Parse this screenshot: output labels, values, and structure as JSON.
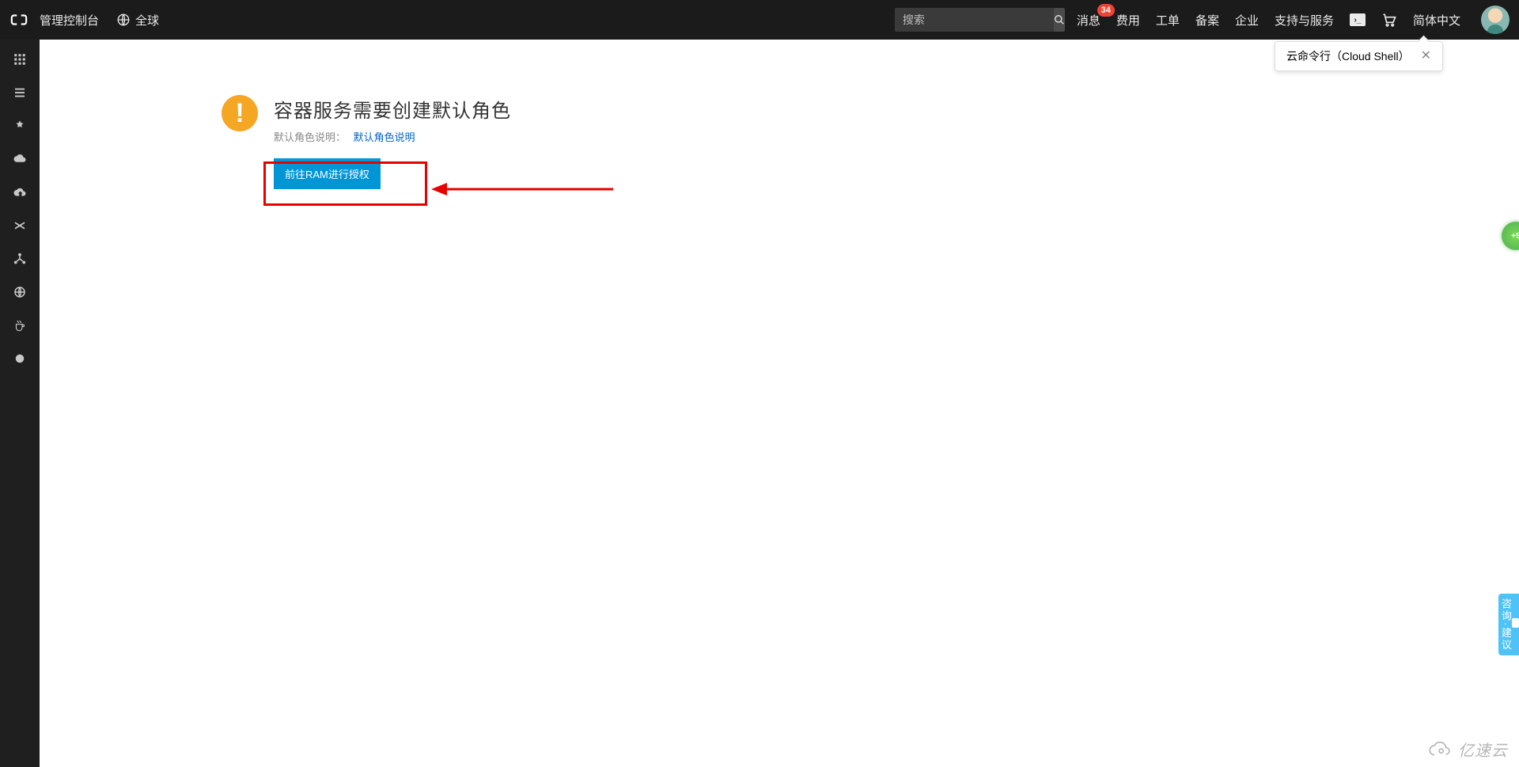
{
  "header": {
    "console_label": "管理控制台",
    "region_label": "全球",
    "search_placeholder": "搜索",
    "nav": {
      "messages": "消息",
      "messages_badge": "34",
      "billing": "费用",
      "tickets": "工单",
      "icp": "备案",
      "enterprise": "企业",
      "support": "支持与服务",
      "language": "简体中文"
    }
  },
  "tooltip": {
    "label": "云命令行（Cloud Shell）"
  },
  "notice": {
    "title": "容器服务需要创建默认角色",
    "subtitle": "默认角色说明：",
    "link": "默认角色说明",
    "button": "前往RAM进行授权"
  },
  "feedback": {
    "label": "咨询·建议"
  },
  "watermark": {
    "text": "亿速云"
  },
  "sidebar_icons": [
    "grid-icon",
    "list-icon",
    "medal-icon",
    "cloud-icon",
    "cloud-upload-icon",
    "shuffle-icon",
    "nodes-icon",
    "globe-small-icon",
    "cup-icon",
    "circle-icon"
  ]
}
